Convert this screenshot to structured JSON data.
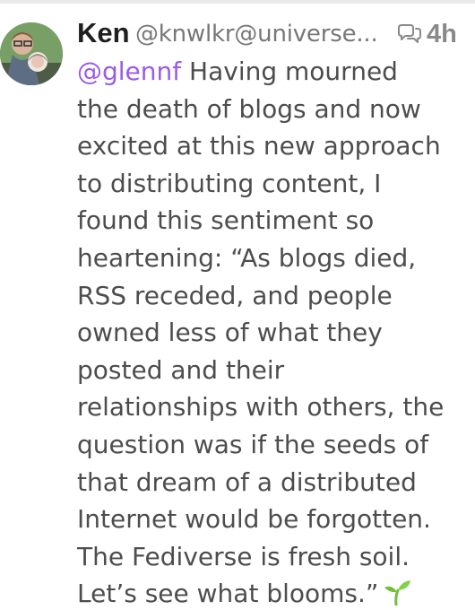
{
  "post": {
    "display_name": "Ken",
    "handle": "@knwlkr@universe...",
    "timestamp": "4h",
    "mention": "@glennf",
    "lines": [
      " Having mourned",
      "the death of blogs and now",
      "excited at this new approach",
      "to distributing content, I",
      "found this sentiment so",
      "heartening: “As blogs died,",
      "RSS receded, and people",
      "owned less of what they",
      "posted and their",
      "relationships with others, the",
      "question was if the seeds of",
      "that dream of a distributed",
      "Internet would be forgotten.",
      "The Fediverse is fresh soil.",
      "Let’s see what blooms.”"
    ],
    "icons": {
      "avatar": "avatar-photo",
      "reply": "reply-thread-icon",
      "emoji": "seedling-icon"
    }
  },
  "colors": {
    "name": "#1f1f1f",
    "handle": "#777777",
    "timestamp": "#8a8a8a",
    "body": "#4d4d4d",
    "mention": "#9a5ce6",
    "sprout": "#6fbf3a"
  }
}
